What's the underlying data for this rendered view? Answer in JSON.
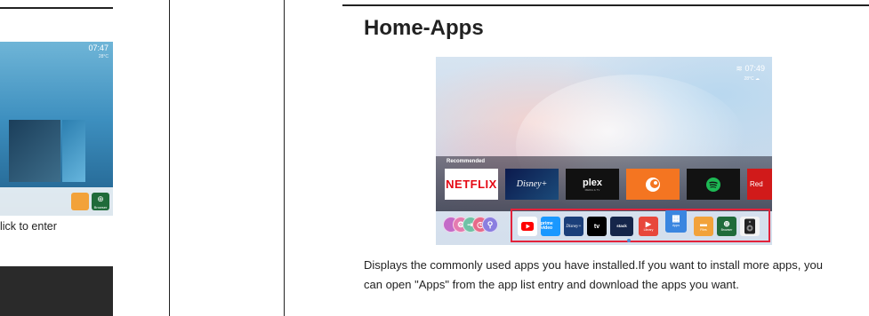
{
  "left_page": {
    "screen": {
      "time": "07:47",
      "weather": "28°C",
      "dock_label": "Browser"
    },
    "caption": "lick to enter"
  },
  "right_page": {
    "title": "Home-Apps",
    "screen": {
      "time": "07:49",
      "weather": "28°C",
      "recommended_label": "Recommended",
      "recommended": [
        "NETFLIX",
        "Disney+",
        "plex",
        "Crunchyroll",
        "Spotify",
        "Red"
      ],
      "plex_sub": "MEDIA & TV",
      "dock": [
        "YouTube",
        "prime video",
        "Disney+",
        "tv",
        "Stack",
        "Library",
        "Apps",
        "Files",
        "Browser",
        "Speaker"
      ],
      "dock_labels": {
        "prime": "prime video",
        "appletv": "tv",
        "stack": "stack",
        "library": "Library",
        "apps": "Apps",
        "files": "Files",
        "browser": "Browser"
      }
    },
    "description": "Displays the commonly used apps you have installed.If you want to install more apps, you can open \"Apps\" from the app list entry and download the apps you want."
  },
  "colors": {
    "netflix_red": "#e50914",
    "highlight_red": "#e2223b",
    "crunchyroll_orange": "#f47521",
    "spotify_green": "#1db954"
  }
}
